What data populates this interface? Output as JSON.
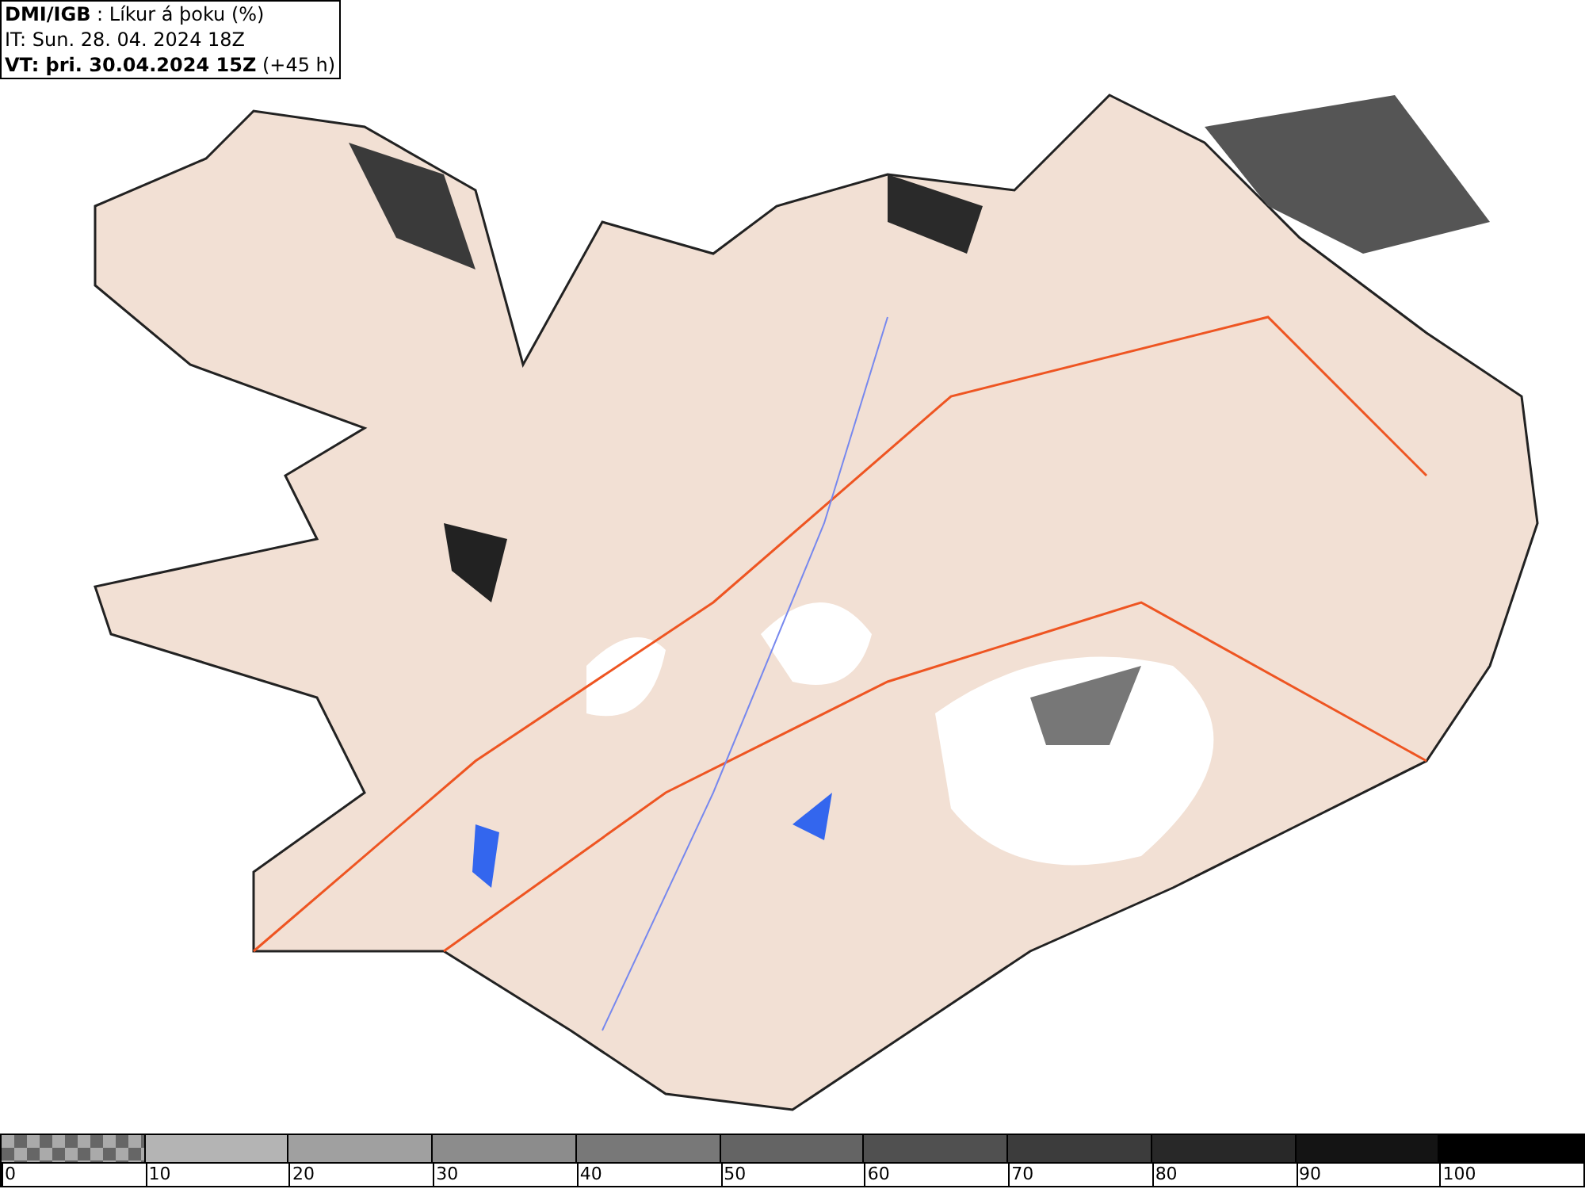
{
  "header": {
    "lines": [
      "**DMI/IGB** : Líkur á þoku (%)",
      "IT: Sun. 28. 04. 2024 18Z",
      "**VT: þri. 30.04.2024 15Z** (+45 h)"
    ]
  },
  "legend": {
    "segments": [
      {
        "kind": "checker",
        "label": "0"
      },
      {
        "kind": "solid",
        "color": "#b4b4b4",
        "label": "10"
      },
      {
        "kind": "solid",
        "color": "#a0a0a0",
        "label": "20"
      },
      {
        "kind": "solid",
        "color": "#8c8c8c",
        "label": "30"
      },
      {
        "kind": "solid",
        "color": "#787878",
        "label": "40"
      },
      {
        "kind": "solid",
        "color": "#646464",
        "label": "50"
      },
      {
        "kind": "solid",
        "color": "#505050",
        "label": "60"
      },
      {
        "kind": "solid",
        "color": "#3c3c3c",
        "label": "70"
      },
      {
        "kind": "solid",
        "color": "#282828",
        "label": "80"
      },
      {
        "kind": "solid",
        "color": "#141414",
        "label": "90"
      },
      {
        "kind": "solid",
        "color": "#000000",
        "label": "100"
      }
    ]
  }
}
